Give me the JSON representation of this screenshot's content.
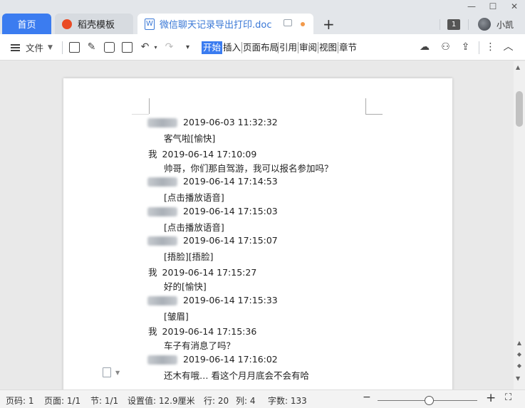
{
  "tabs": {
    "home": "首页",
    "template": "稻壳模板",
    "document": "微信聊天记录导出打印.doc",
    "new_tab": "+"
  },
  "window": {
    "badge": "1",
    "username": "小凯",
    "minimize": "—",
    "maximize": "☐",
    "close": "✕"
  },
  "toolbar": {
    "file_menu": "文件",
    "ribbon_tabs": [
      "开始",
      "插入",
      "页面布局",
      "引用",
      "审阅",
      "视图",
      "章节"
    ],
    "active_tab": "开始"
  },
  "document": {
    "messages": [
      {
        "sender": "",
        "blurred": true,
        "time": "2019-06-03 11:32:32",
        "text": "客气啦[愉快]"
      },
      {
        "sender": "我",
        "blurred": false,
        "time": "2019-06-14 17:10:09",
        "text": "帅哥，你们那自驾游，我可以报名参加吗？"
      },
      {
        "sender": "",
        "blurred": true,
        "time": "2019-06-14 17:14:53",
        "text": "[点击播放语音]"
      },
      {
        "sender": "",
        "blurred": true,
        "time": "2019-06-14 17:15:03",
        "text": "[点击播放语音]"
      },
      {
        "sender": "",
        "blurred": true,
        "time": "2019-06-14 17:15:07",
        "text": "[捂脸][捂脸]"
      },
      {
        "sender": "我",
        "blurred": false,
        "time": "2019-06-14 17:15:27",
        "text": "好的[愉快]"
      },
      {
        "sender": "",
        "blurred": true,
        "time": "2019-06-14 17:15:33",
        "text": "[皱眉]"
      },
      {
        "sender": "我",
        "blurred": false,
        "time": "2019-06-14 17:15:36",
        "text": "车子有消息了吗？"
      },
      {
        "sender": "",
        "blurred": true,
        "time": "2019-06-14 17:16:02",
        "text": "还木有哦… 看这个月月底会不会有哈"
      }
    ]
  },
  "statusbar": {
    "page_num": "页码: 1",
    "page": "页面: 1/1",
    "section": "节: 1/1",
    "setting": "设置值: 12.9厘米",
    "row": "行: 20",
    "col": "列: 4",
    "word_count": "字数: 133"
  },
  "colors": {
    "accent": "#3b7cf0",
    "doc_tab_text": "#3a78d6",
    "template_logo": "#ea4b25",
    "modified_dot": "#f2994a"
  }
}
